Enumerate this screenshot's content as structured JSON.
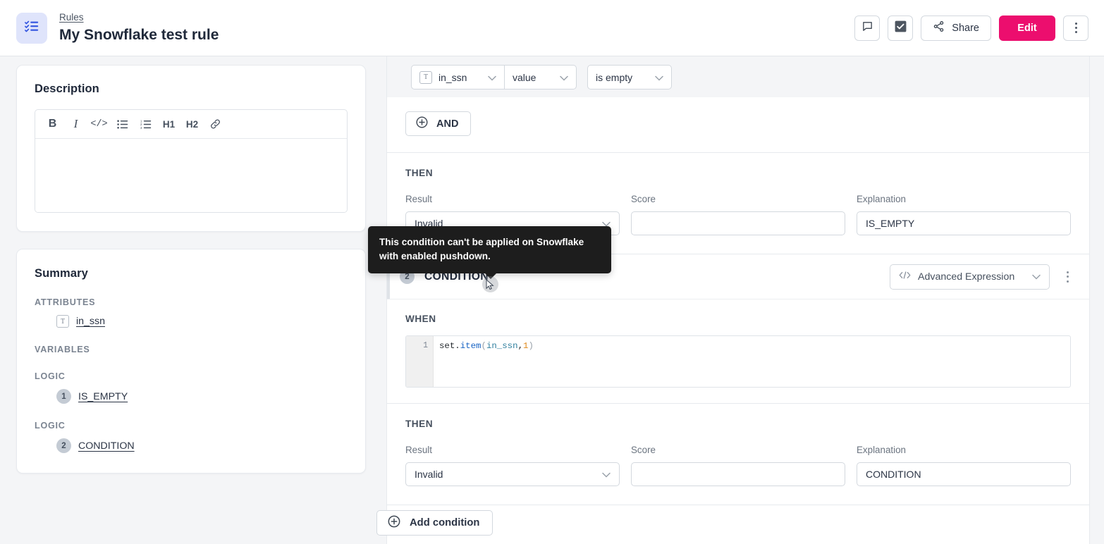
{
  "header": {
    "logo_icon": "checklist-icon",
    "breadcrumb": "Rules",
    "title": "My Snowflake test rule",
    "actions": {
      "comment_icon": "comment-icon",
      "approve_icon": "checkbox-checked-icon",
      "share_icon": "share-icon",
      "share_label": "Share",
      "edit_label": "Edit",
      "more_icon": "vertical-dots-icon"
    },
    "accent_color": "#ec0e6e"
  },
  "description": {
    "heading": "Description",
    "toolbar": [
      {
        "name": "bold-button",
        "label": "B"
      },
      {
        "name": "italic-button",
        "label": "I"
      },
      {
        "name": "code-button",
        "label": "</>"
      },
      {
        "name": "bullet-list-button",
        "label": "☰"
      },
      {
        "name": "numbered-list-button",
        "label": "☰"
      },
      {
        "name": "heading1-button",
        "label": "H1"
      },
      {
        "name": "heading2-button",
        "label": "H2"
      },
      {
        "name": "link-button",
        "label": "🔗"
      }
    ],
    "body_value": "",
    "body_placeholder": ""
  },
  "summary": {
    "heading": "Summary",
    "groups": [
      {
        "label": "ATTRIBUTES",
        "items": [
          {
            "badge": "T",
            "badge_type": "type-icon",
            "text": "in_ssn"
          }
        ]
      },
      {
        "label": "VARIABLES",
        "items": []
      },
      {
        "label": "LOGIC",
        "items": [
          {
            "badge": "1",
            "badge_type": "number",
            "text": "IS_EMPTY"
          }
        ]
      },
      {
        "label": "LOGIC",
        "items": [
          {
            "badge": "2",
            "badge_type": "number",
            "text": "CONDITION"
          }
        ]
      }
    ]
  },
  "condition1": {
    "when_row": {
      "attribute_icon": "T",
      "attribute_value": "in_ssn",
      "property_value": "value",
      "operator_value": "is empty"
    },
    "and_button": "AND",
    "then": {
      "label": "THEN",
      "fields": [
        {
          "label": "Result",
          "value": "Invalid",
          "type": "select"
        },
        {
          "label": "Score",
          "value": "",
          "type": "input"
        },
        {
          "label": "Explanation",
          "value": "IS_EMPTY",
          "type": "input"
        }
      ]
    }
  },
  "condition2": {
    "badge": "2",
    "title": "CONDITION",
    "mode_icon": "code-icon",
    "mode_label": "Advanced Expression",
    "kebab_icon": "vertical-dots-icon",
    "when": {
      "label": "WHEN",
      "line_number": "1",
      "code_tokens": [
        {
          "text": "set.",
          "kind": "plain"
        },
        {
          "text": "item",
          "kind": "fn"
        },
        {
          "text": "(",
          "kind": "paren"
        },
        {
          "text": "in_ssn",
          "kind": "var"
        },
        {
          "text": ",",
          "kind": "plain"
        },
        {
          "text": "1",
          "kind": "num"
        },
        {
          "text": ")",
          "kind": "paren"
        }
      ],
      "code_text": "set.item(in_ssn,1)"
    },
    "then": {
      "label": "THEN",
      "fields": [
        {
          "label": "Result",
          "value": "Invalid",
          "type": "select"
        },
        {
          "label": "Score",
          "value": "",
          "type": "input"
        },
        {
          "label": "Explanation",
          "value": "CONDITION",
          "type": "input"
        }
      ]
    }
  },
  "footer": {
    "add_condition_label": "Add condition",
    "add_icon": "plus-circle-icon"
  },
  "tooltip": {
    "text": "This condition can't be applied on Snowflake with enabled pushdown.",
    "background": "#1d1d1d"
  }
}
